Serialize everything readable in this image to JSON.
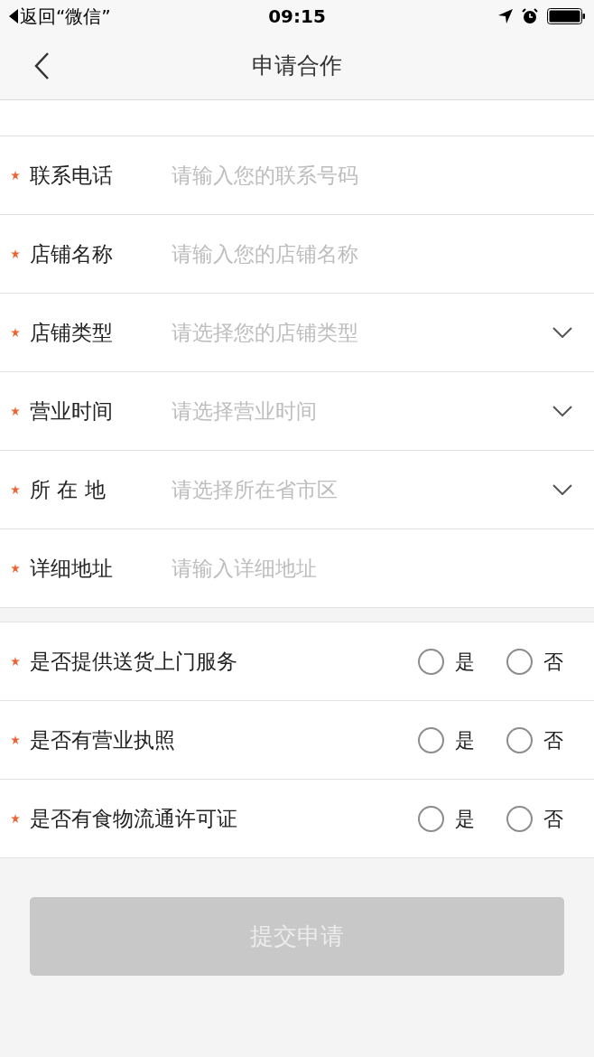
{
  "status_bar": {
    "back_label": "返回“微信”",
    "time": "09:15"
  },
  "nav": {
    "title": "申请合作"
  },
  "fields": [
    {
      "kind": "input",
      "label": "联系电话",
      "placeholder": "请输入您的联系号码",
      "required": true
    },
    {
      "kind": "input",
      "label": "店铺名称",
      "placeholder": "请输入您的店铺名称",
      "required": true
    },
    {
      "kind": "select",
      "label": "店铺类型",
      "placeholder": "请选择您的店铺类型",
      "required": true
    },
    {
      "kind": "select",
      "label": "营业时间",
      "placeholder": "请选择营业时间",
      "required": true
    },
    {
      "kind": "select",
      "label": "所 在 地",
      "placeholder": "请选择所在省市区",
      "required": true
    },
    {
      "kind": "input",
      "label": "详细地址",
      "placeholder": "请输入详细地址",
      "required": true
    }
  ],
  "questions": [
    {
      "label": "是否提供送货上门服务",
      "required": true,
      "options": [
        {
          "label": "是",
          "selected": false
        },
        {
          "label": "否",
          "selected": false
        }
      ]
    },
    {
      "label": "是否有营业执照",
      "required": true,
      "options": [
        {
          "label": "是",
          "selected": false
        },
        {
          "label": "否",
          "selected": false
        }
      ]
    },
    {
      "label": "是否有食物流通许可证",
      "required": true,
      "options": [
        {
          "label": "是",
          "selected": false
        },
        {
          "label": "否",
          "selected": false
        }
      ]
    }
  ],
  "submit": {
    "label": "提交申请",
    "disabled": true
  }
}
